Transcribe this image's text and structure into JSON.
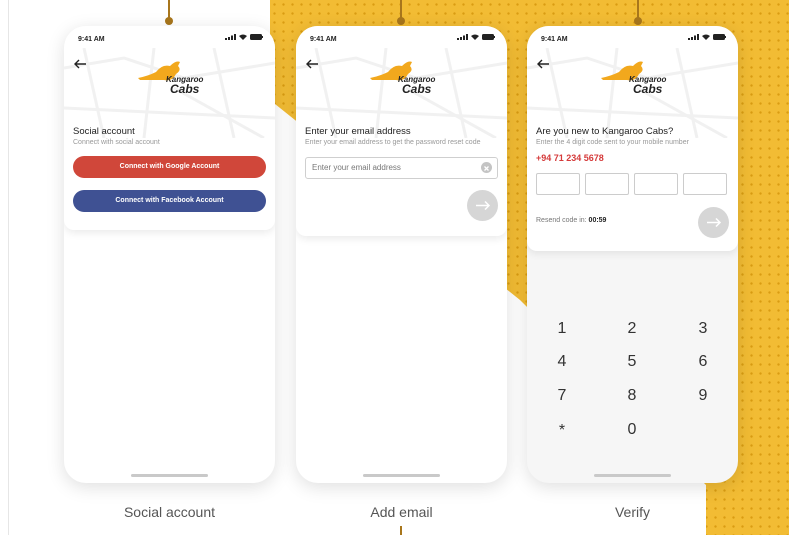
{
  "status_bar": {
    "time": "9:41 AM"
  },
  "brand": {
    "line1": "Kangaroo",
    "line2": "Cabs"
  },
  "screen1": {
    "title": "Social account",
    "subtitle": "Connect with social account",
    "google_label": "Connect with Google Account",
    "facebook_label": "Connect with Facebook Account",
    "caption": "Social account"
  },
  "screen2": {
    "title": "Enter your email address",
    "subtitle": "Enter your email address to get the password reset code",
    "input_placeholder": "Enter your email address",
    "caption": "Add email"
  },
  "screen3": {
    "title": "Are you new to Kangaroo Cabs?",
    "subtitle": "Enter the 4 digit code sent to your mobile number",
    "phone": "+94 71 234 5678",
    "resend_label": "Resend code in:",
    "countdown": "00:59",
    "keys": [
      "1",
      "2",
      "3",
      "4",
      "5",
      "6",
      "7",
      "8",
      "9",
      "*",
      "0"
    ],
    "caption": "Verify"
  },
  "colors": {
    "accent_yellow": "#f2bc34",
    "google": "#d0473a",
    "facebook": "#3f5193",
    "phone_red": "#d53a3a"
  }
}
